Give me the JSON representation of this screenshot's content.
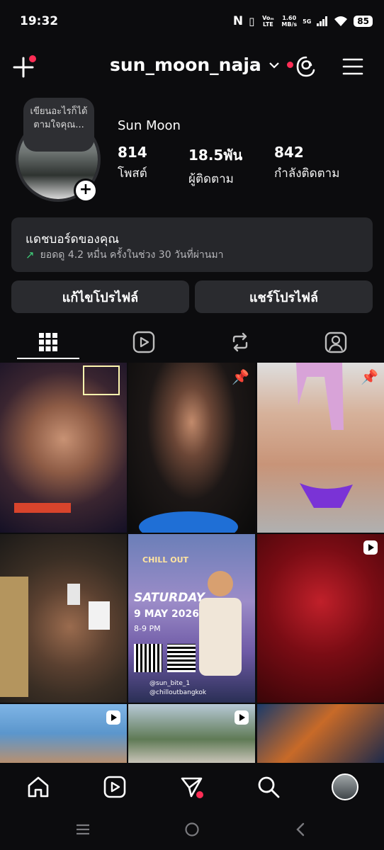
{
  "status_bar": {
    "time": "19:32",
    "network": "Voₘ LTE",
    "speed_value": "1.60",
    "speed_unit": "MB/s",
    "signal_type": "5G",
    "battery": "85"
  },
  "header": {
    "username": "sun_moon_naja"
  },
  "profile": {
    "note": "เขียนอะไรก็ได้ตามใจคุณ...",
    "display_name": "Sun Moon",
    "stats": [
      {
        "value": "814",
        "label": "โพสต์"
      },
      {
        "value": "18.5พัน",
        "label": "ผู้ติดตาม"
      },
      {
        "value": "842",
        "label": "กำลังติดตาม"
      }
    ]
  },
  "dashboard": {
    "title": "แดชบอร์ดของคุณ",
    "subtitle": "ยอดดู 4.2 หมื่น ครั้งในช่วง 30 วันที่ผ่านมา"
  },
  "actions": {
    "edit_profile": "แก้ไขโปรไฟล์",
    "share_profile": "แชร์โปรไฟล์"
  },
  "tabs": [
    "grid",
    "reels",
    "reposts",
    "tagged"
  ],
  "posts": {
    "promo_brand_top": "CHILL OUT",
    "promo_day": "SATURDAY",
    "promo_date": "9 MAY 2026",
    "promo_time": "8-9 PM",
    "promo_handle_1": "@sun_bite_1",
    "promo_handle_2": "@chilloutbangkok"
  },
  "colors": {
    "background": "#0c0c0e",
    "card": "#26272b",
    "accent_red": "#ff2d55",
    "trend_green": "#3fd07a"
  }
}
